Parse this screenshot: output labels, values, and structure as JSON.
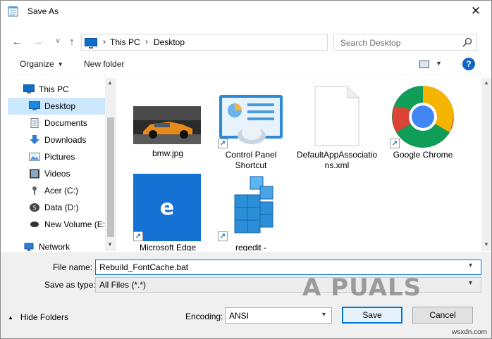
{
  "window": {
    "title": "Save As",
    "close_glyph": "✕"
  },
  "nav": {
    "back_glyph": "←",
    "forward_glyph": "→",
    "history_glyph": "˅",
    "up_glyph": "↑",
    "path": [
      "This PC",
      "Desktop"
    ],
    "separator": "›",
    "refresh_glyph": "↻",
    "search_placeholder": "Search Desktop"
  },
  "toolbar": {
    "organize": "Organize",
    "new_folder": "New folder",
    "help": "?"
  },
  "sidebar": {
    "items": [
      {
        "label": "This PC",
        "icon": "pc-icon"
      },
      {
        "label": "Desktop",
        "icon": "desktop-icon",
        "selected": true
      },
      {
        "label": "Documents",
        "icon": "documents-icon"
      },
      {
        "label": "Downloads",
        "icon": "downloads-icon"
      },
      {
        "label": "Pictures",
        "icon": "pictures-icon"
      },
      {
        "label": "Videos",
        "icon": "videos-icon"
      },
      {
        "label": "Acer (C:)",
        "icon": "drive-icon"
      },
      {
        "label": "Data (D:)",
        "icon": "drive-icon"
      },
      {
        "label": "New Volume (E:)",
        "icon": "drive-icon"
      },
      {
        "label": "Network",
        "icon": "network-icon"
      }
    ]
  },
  "files": [
    {
      "name": "bmw.jpg",
      "icon": "photo-thumbnail"
    },
    {
      "name": "Control Panel Shortcut",
      "icon": "control-panel-icon",
      "shortcut": true
    },
    {
      "name": "DefaultAppAssociations.xml",
      "icon": "document-icon"
    },
    {
      "name": "Google Chrome",
      "icon": "chrome-icon",
      "shortcut": true
    },
    {
      "name": "Microsoft Edge",
      "icon": "edge-icon",
      "shortcut": true
    },
    {
      "name": "regedit -",
      "icon": "regedit-icon",
      "shortcut": true
    }
  ],
  "form": {
    "filename_label": "File name:",
    "filename_value": "Rebuild_FontCache.bat",
    "type_label": "Save as type:",
    "type_value": "All Files  (*.*)",
    "hide_folders": "Hide Folders",
    "encoding_label": "Encoding:",
    "encoding_value": "ANSI",
    "save": "Save",
    "cancel": "Cancel"
  },
  "watermark": {
    "text": "A  PUALS",
    "site": "wsxdn.com"
  },
  "colors": {
    "accent": "#0078d7",
    "selection": "#cce8ff",
    "panel": "#f0f0f0"
  }
}
